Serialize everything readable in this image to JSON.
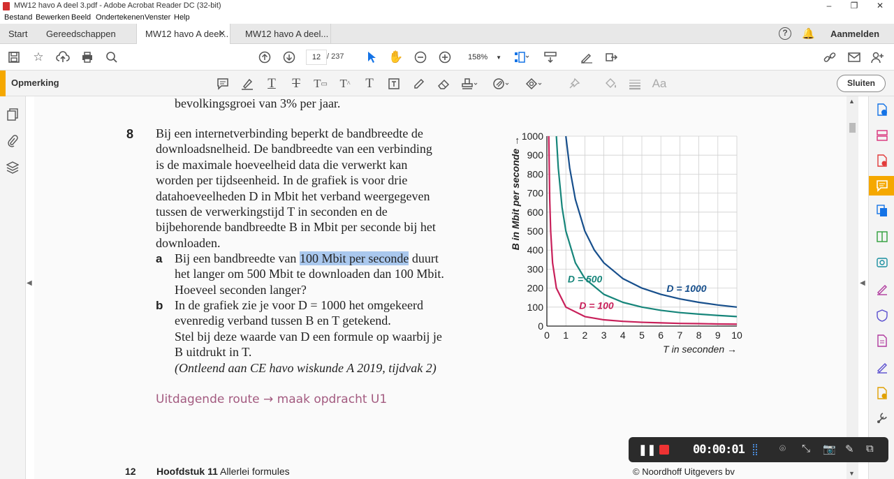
{
  "window": {
    "title": "MW12 havo A deel 3.pdf - Adobe Acrobat Reader DC (32-bit)",
    "minimize": "–",
    "maximize": "❐",
    "close": "✕"
  },
  "menu": [
    "Bestand",
    "Bewerken",
    "Beeld",
    "Ondertekenen",
    "Venster",
    "Help"
  ],
  "tabs": {
    "start": "Start",
    "tools": "Gereedschappen",
    "doc1": "MW12 havo A deel...",
    "doc1_close": "✕",
    "doc2": "MW12 havo A deel...",
    "signin": "Aanmelden"
  },
  "toolbar": {
    "page_current": "12",
    "page_total": "/ 237",
    "zoom": "158%"
  },
  "comment_bar": {
    "title": "Opmerking",
    "close_label": "Sluiten"
  },
  "document": {
    "prev_line": "bevolkingsgroei van 3% per jaar.",
    "question_number": "8",
    "intro_lines": [
      "Bij een internetverbinding beperkt de bandbreedte de",
      "downloadsnelheid. De bandbreedte van een verbinding",
      "is de maximale hoeveelheid data die verwerkt kan",
      "worden per tijdseenheid. In de grafiek is voor drie",
      "datahoeveelheden D in Mbit het verband weergegeven",
      "tussen de verwerkingstijd T in seconden en de",
      "bijbehorende bandbreedte B in Mbit per seconde bij het",
      "downloaden."
    ],
    "a_label": "a",
    "a_line1_before": "Bij een bandbreedte van ",
    "a_line1_highlight": "100 Mbit per seconde",
    "a_line1_after": " duurt",
    "a_line2": "het langer om 500 Mbit te downloaden dan 100 Mbit.",
    "a_line3": "Hoeveel seconden langer?",
    "b_label": "b",
    "b_lines": [
      "In de grafiek zie je voor D = 1000 het omgekeerd",
      "evenredig verband tussen B en T getekend.",
      "Stel bij deze waarde van D een formule op waarbij je",
      "B uitdrukt in T."
    ],
    "source": "(Ontleend aan CE havo wiskunde A 2019, tijdvak 2)",
    "route": "Uitdagende route → maak opdracht U1",
    "footer_page": "12",
    "footer_chapter_bold": "Hoofdstuk 11",
    "footer_chapter": " Allerlei formules",
    "footer_copyright": "© Noordhoff Uitgevers bv"
  },
  "chart_data": {
    "type": "line",
    "ylabel": "B in Mbit per seconde →",
    "xlabel": "T in seconden →",
    "xlim": [
      0,
      10
    ],
    "ylim": [
      0,
      1000
    ],
    "xticks": [
      "0",
      "1",
      "2",
      "3",
      "4",
      "5",
      "6",
      "7",
      "8",
      "9",
      "10"
    ],
    "yticks": [
      "0",
      "100",
      "200",
      "300",
      "400",
      "500",
      "600",
      "700",
      "800",
      "900",
      "1000"
    ],
    "grid": true,
    "series": [
      {
        "name": "D = 100",
        "color": "#c8205a",
        "x": [
          0.1,
          0.15,
          0.2,
          0.3,
          0.5,
          1,
          2,
          3,
          4,
          5,
          6,
          7,
          8,
          9,
          10
        ],
        "values": [
          1000,
          667,
          500,
          333,
          200,
          100,
          50,
          33,
          25,
          20,
          17,
          14,
          13,
          11,
          10
        ]
      },
      {
        "name": "D = 500",
        "color": "#16857a",
        "x": [
          0.5,
          0.6,
          0.8,
          1,
          1.5,
          2,
          3,
          4,
          5,
          6,
          7,
          8,
          9,
          10
        ],
        "values": [
          1000,
          833,
          625,
          500,
          333,
          250,
          167,
          125,
          100,
          83,
          71,
          63,
          56,
          50
        ]
      },
      {
        "name": "D = 1000",
        "color": "#174f8c",
        "x": [
          1,
          1.2,
          1.5,
          2,
          2.5,
          3,
          4,
          5,
          6,
          7,
          8,
          9,
          10
        ],
        "values": [
          1000,
          833,
          667,
          500,
          400,
          333,
          250,
          200,
          167,
          143,
          125,
          111,
          100
        ]
      }
    ]
  },
  "recorder": {
    "time": "00:00:01"
  }
}
